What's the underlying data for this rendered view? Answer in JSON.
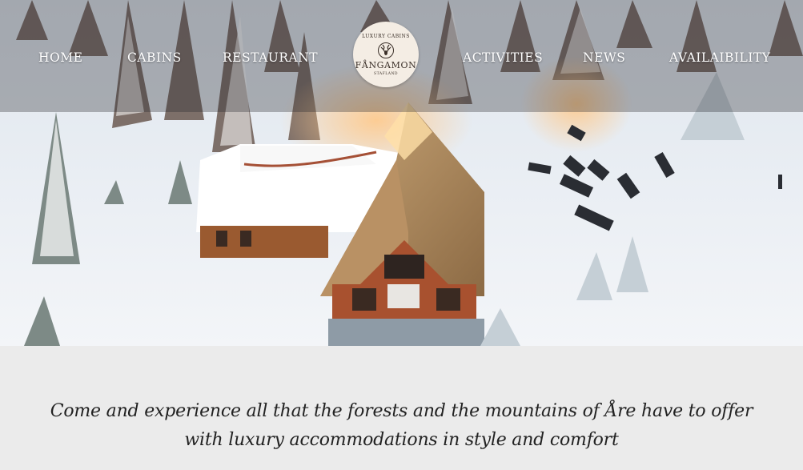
{
  "nav": {
    "items": [
      {
        "label": "HOME"
      },
      {
        "label": "CABINS"
      },
      {
        "label": "RESTAURANT"
      },
      {
        "label": "ACTIVITIES"
      },
      {
        "label": "NEWS"
      },
      {
        "label": "AVAILAIBILITY"
      }
    ]
  },
  "logo": {
    "top_text": "LUXURY CABINS",
    "name": "FÅNGAMON",
    "sub_text": "STAFLAND",
    "icon": "deer-emblem-icon"
  },
  "tagline": {
    "line1": "Come and experience all that the forests and the mountains of Åre have to offer",
    "line2": "with luxury accommodations in style and comfort"
  },
  "colors": {
    "nav_text": "#ffffff",
    "logo_bg": "#f4ede4",
    "page_bg": "#ebebeb",
    "tagline_text": "#222222"
  }
}
